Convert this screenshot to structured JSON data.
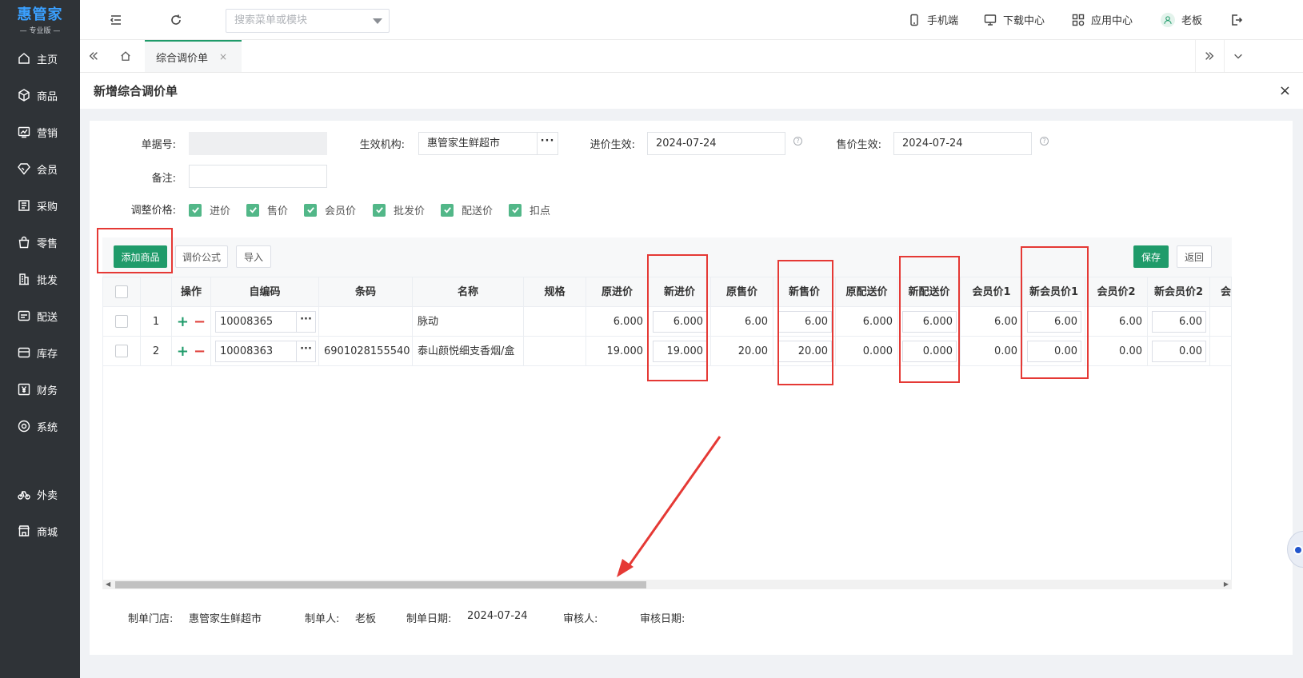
{
  "app": {
    "logo_title": "惠管家",
    "logo_sub": "专业版"
  },
  "sidebar": {
    "items": [
      {
        "label": "主页",
        "icon": "home-icon"
      },
      {
        "label": "商品",
        "icon": "cube-icon"
      },
      {
        "label": "营销",
        "icon": "chart-icon"
      },
      {
        "label": "会员",
        "icon": "diamond-icon"
      },
      {
        "label": "采购",
        "icon": "purchase-icon"
      },
      {
        "label": "零售",
        "icon": "bag-icon"
      },
      {
        "label": "批发",
        "icon": "building-icon"
      },
      {
        "label": "配送",
        "icon": "truck-icon"
      },
      {
        "label": "库存",
        "icon": "inventory-icon"
      },
      {
        "label": "财务",
        "icon": "yen-icon"
      },
      {
        "label": "系统",
        "icon": "settings-icon"
      },
      {
        "label": "外卖",
        "icon": "bike-icon"
      },
      {
        "label": "商城",
        "icon": "store-icon"
      }
    ]
  },
  "topbar": {
    "search_placeholder": "搜索菜单或模块",
    "mobile": "手机端",
    "download": "下载中心",
    "apps": "应用中心",
    "user": "老板"
  },
  "tabs": {
    "active": "综合调价单",
    "close": "×"
  },
  "page": {
    "title": "新增综合调价单",
    "close": "×"
  },
  "form": {
    "doc_no_label": "单据号:",
    "doc_no_value": "",
    "org_label": "生效机构:",
    "org_value": "惠管家生鲜超市",
    "org_btn": "···",
    "purchase_eff_label": "进价生效:",
    "purchase_eff_value": "2024-07-24",
    "sale_eff_label": "售价生效:",
    "sale_eff_value": "2024-07-24",
    "remark_label": "备注:",
    "remark_value": "",
    "adjust_label": "调整价格:",
    "checks": [
      "进价",
      "售价",
      "会员价",
      "批发价",
      "配送价",
      "扣点"
    ]
  },
  "toolbar": {
    "add_goods": "添加商品",
    "formula": "调价公式",
    "import": "导入",
    "save": "保存",
    "back": "返回"
  },
  "table": {
    "headers": [
      "操作",
      "自编码",
      "条码",
      "名称",
      "规格",
      "原进价",
      "新进价",
      "原售价",
      "新售价",
      "原配送价",
      "新配送价",
      "会员价1",
      "新会员价1",
      "会员价2",
      "新会员价2",
      "会"
    ],
    "rows": [
      {
        "index": "1",
        "code": "10008365",
        "barcode": "",
        "name": "脉动",
        "spec": "",
        "old_purchase": "6.000",
        "new_purchase": "6.000",
        "old_sale": "6.00",
        "new_sale": "6.00",
        "old_delivery": "6.000",
        "new_delivery": "6.000",
        "member1": "6.00",
        "new_member1": "6.00",
        "member2": "6.00",
        "new_member2": "6.00"
      },
      {
        "index": "2",
        "code": "10008363",
        "barcode": "6901028155540",
        "name": "泰山颜悦细支香烟/盒",
        "spec": "",
        "old_purchase": "19.000",
        "new_purchase": "19.000",
        "old_sale": "20.00",
        "new_sale": "20.00",
        "old_delivery": "0.000",
        "new_delivery": "0.000",
        "member1": "0.00",
        "new_member1": "0.00",
        "member2": "0.00",
        "new_member2": "0.00"
      }
    ]
  },
  "footer": {
    "store_label": "制单门店:",
    "store_value": "惠管家生鲜超市",
    "maker_label": "制单人:",
    "maker_value": "老板",
    "date_label": "制单日期:",
    "date_value": "2024-07-24",
    "auditor_label": "审核人:",
    "audit_date_label": "审核日期:"
  },
  "colors": {
    "primary": "#1f9b6a",
    "sidebar": "#2f3337",
    "annotation": "#e53935",
    "check": "#52b788"
  }
}
